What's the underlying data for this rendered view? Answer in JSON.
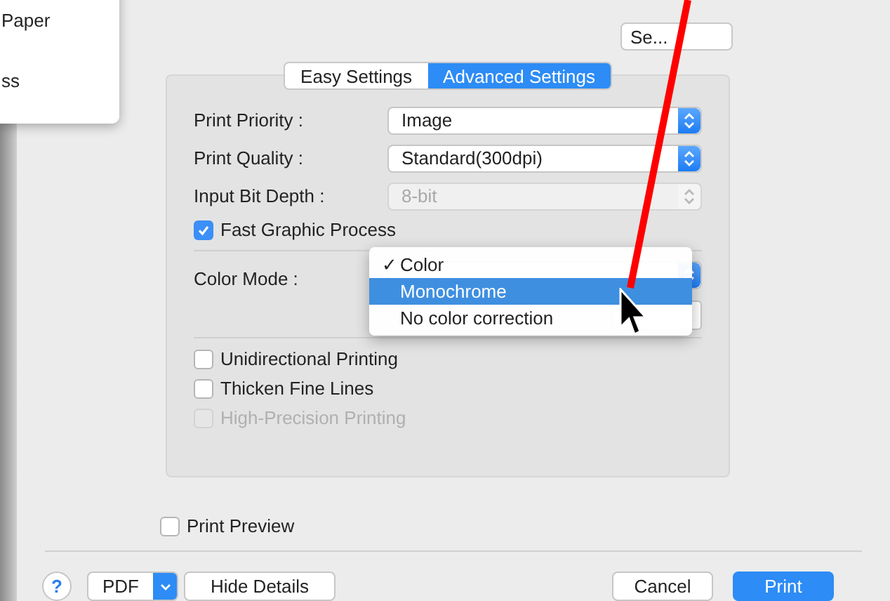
{
  "side_menu": {
    "items": [
      "Paper",
      "ss"
    ]
  },
  "settings_button": "Se...",
  "tabs": [
    {
      "label": "Easy Settings",
      "selected": false
    },
    {
      "label": "Advanced Settings",
      "selected": true
    }
  ],
  "fields": [
    {
      "label": "Print Priority :",
      "value": "Image",
      "disabled": false
    },
    {
      "label": "Print Quality :",
      "value": "Standard(300dpi)",
      "disabled": false
    },
    {
      "label": "Input Bit Depth :",
      "value": "8-bit",
      "disabled": true
    }
  ],
  "fast_graphic": {
    "label": "Fast Graphic Process",
    "checked": true
  },
  "color_mode": {
    "label": "Color Mode :",
    "menu": [
      {
        "label": "Color",
        "checked": true,
        "selected": false
      },
      {
        "label": "Monochrome",
        "checked": false,
        "selected": true
      },
      {
        "label": "No color correction",
        "checked": false,
        "selected": false
      }
    ],
    "check_mark": "✓"
  },
  "options": [
    {
      "label": "Unidirectional Printing",
      "checked": false,
      "disabled": false
    },
    {
      "label": "Thicken Fine Lines",
      "checked": false,
      "disabled": false
    },
    {
      "label": "High-Precision Printing",
      "checked": false,
      "disabled": true
    }
  ],
  "print_preview": {
    "label": "Print Preview",
    "checked": false
  },
  "footer": {
    "help": "?",
    "pdf": "PDF",
    "hide_details": "Hide Details",
    "cancel": "Cancel",
    "print": "Print"
  }
}
